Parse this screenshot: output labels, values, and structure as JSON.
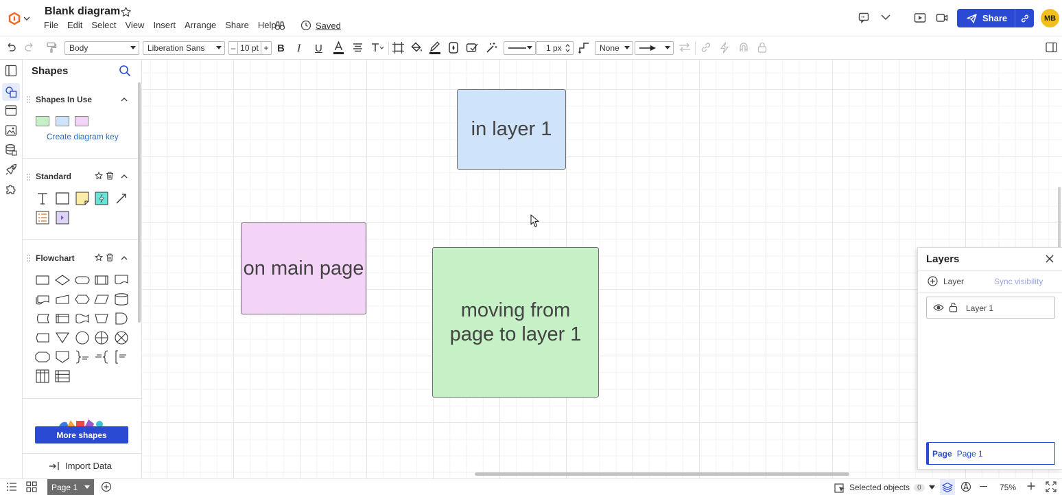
{
  "app": {
    "title": "Blank diagram",
    "menu": [
      "File",
      "Edit",
      "Select",
      "View",
      "Insert",
      "Arrange",
      "Share",
      "Help"
    ],
    "saved_label": "Saved",
    "share_label": "Share",
    "avatar_initials": "MB",
    "brand_color": "#2a4ad4"
  },
  "toolbar": {
    "text_style": "Body",
    "font_family": "Liberation Sans",
    "font_size": "10 pt",
    "font_minus": "–",
    "font_plus": "+",
    "line_width": "1 px",
    "arrow_start": "None"
  },
  "shapes_panel": {
    "title": "Shapes",
    "sections": {
      "in_use": {
        "title": "Shapes In Use",
        "swatches": [
          "#c6f1c6",
          "#cfe3fb",
          "#f3d4f7"
        ]
      },
      "standard": {
        "title": "Standard"
      },
      "flowchart": {
        "title": "Flowchart"
      }
    },
    "diagram_key_link": "Create diagram key",
    "more_shapes": "More shapes",
    "import_data": "Import Data"
  },
  "canvas": {
    "shapes": [
      {
        "text": "in layer 1",
        "fill": "#cfe3fb"
      },
      {
        "text": "on main page",
        "fill": "#f3d4f7"
      },
      {
        "text": "moving from page to layer 1",
        "fill": "#c6f1c6"
      }
    ]
  },
  "layers_panel": {
    "title": "Layers",
    "add_layer": "Layer",
    "sync_visibility": "Sync visibility",
    "layers": [
      "Layer 1"
    ],
    "page_key": "Page",
    "page_value": "Page 1"
  },
  "bottom": {
    "page_tab": "Page 1",
    "selected_objects": "Selected objects",
    "selected_count": "0",
    "zoom": "75%"
  }
}
